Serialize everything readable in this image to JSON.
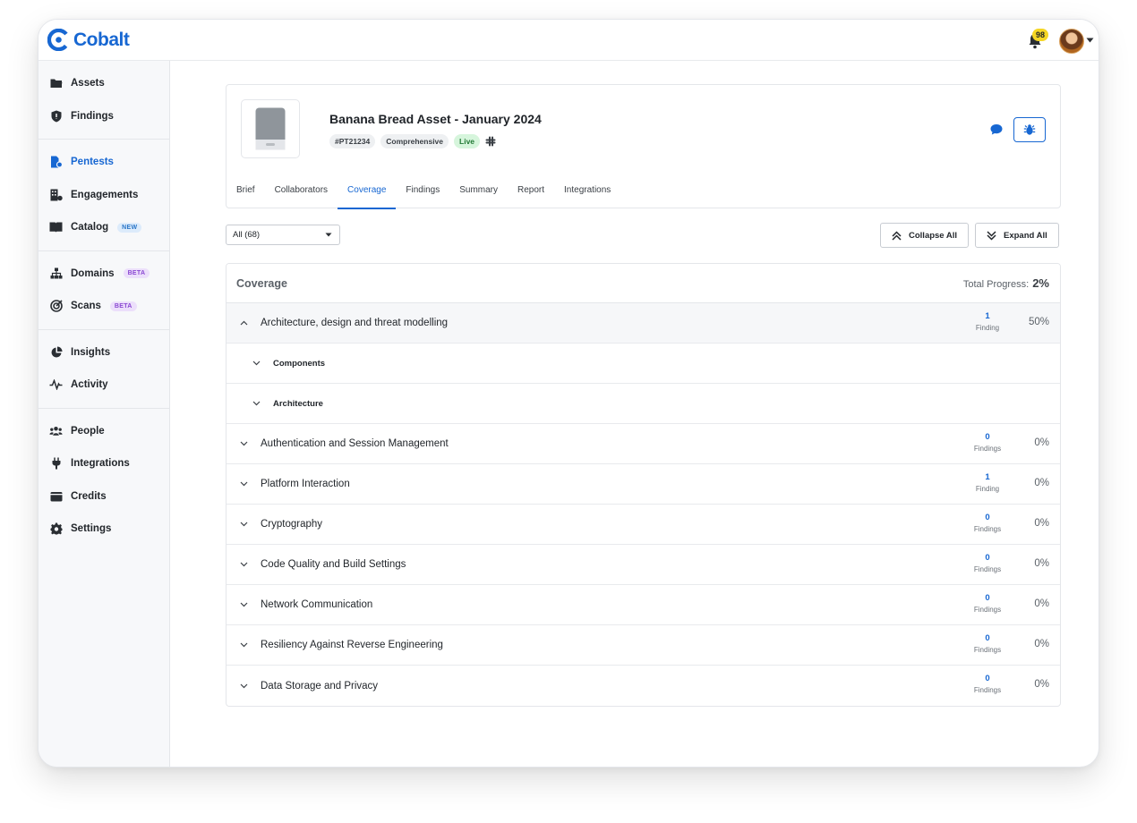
{
  "app": {
    "name": "Cobalt"
  },
  "notifications": {
    "count": "98"
  },
  "sidebar": {
    "groups": [
      [
        {
          "label": "Assets",
          "icon": "folder-icon"
        },
        {
          "label": "Findings",
          "icon": "shield-icon"
        }
      ],
      [
        {
          "label": "Pentests",
          "icon": "pentest-icon",
          "active": true
        },
        {
          "label": "Engagements",
          "icon": "building-icon"
        },
        {
          "label": "Catalog",
          "icon": "book-icon",
          "badge": "NEW"
        }
      ],
      [
        {
          "label": "Domains",
          "icon": "sitemap-icon",
          "badge": "BETA"
        },
        {
          "label": "Scans",
          "icon": "radar-icon",
          "badge": "BETA"
        }
      ],
      [
        {
          "label": "Insights",
          "icon": "pie-chart-icon"
        },
        {
          "label": "Activity",
          "icon": "pulse-icon"
        }
      ],
      [
        {
          "label": "People",
          "icon": "people-icon"
        },
        {
          "label": "Integrations",
          "icon": "plug-icon"
        },
        {
          "label": "Credits",
          "icon": "wallet-icon"
        },
        {
          "label": "Settings",
          "icon": "gear-icon"
        }
      ]
    ]
  },
  "asset": {
    "title": "Banana Bread Asset - January 2024",
    "tags": {
      "id": "#PT21234",
      "type": "Comprehensive",
      "status": "Live"
    }
  },
  "tabs": [
    "Brief",
    "Collaborators",
    "Coverage",
    "Findings",
    "Summary",
    "Report",
    "Integrations"
  ],
  "active_tab": "Coverage",
  "toolbar": {
    "filter_value": "All (68)",
    "collapse_label": "Collapse All",
    "expand_label": "Expand All"
  },
  "coverage": {
    "title": "Coverage",
    "total_label": "Total Progress:",
    "total_value": "2%",
    "rows": [
      {
        "label": "Architecture, design and threat modelling",
        "count": "1",
        "count_word": "Finding",
        "pct": "50%",
        "expanded": true,
        "children": [
          "Components",
          "Architecture"
        ]
      },
      {
        "label": "Authentication and Session Management",
        "count": "0",
        "count_word": "Findings",
        "pct": "0%"
      },
      {
        "label": "Platform Interaction",
        "count": "1",
        "count_word": "Finding",
        "pct": "0%"
      },
      {
        "label": "Cryptography",
        "count": "0",
        "count_word": "Findings",
        "pct": "0%"
      },
      {
        "label": "Code Quality and Build Settings",
        "count": "0",
        "count_word": "Findings",
        "pct": "0%"
      },
      {
        "label": "Network Communication",
        "count": "0",
        "count_word": "Findings",
        "pct": "0%"
      },
      {
        "label": "Resiliency Against Reverse Engineering",
        "count": "0",
        "count_word": "Findings",
        "pct": "0%"
      },
      {
        "label": "Data Storage and Privacy",
        "count": "0",
        "count_word": "Findings",
        "pct": "0%"
      }
    ]
  },
  "colors": {
    "brand": "#1767d2",
    "live_bg": "#d6f5dc",
    "notify_badge": "#f5d624"
  }
}
